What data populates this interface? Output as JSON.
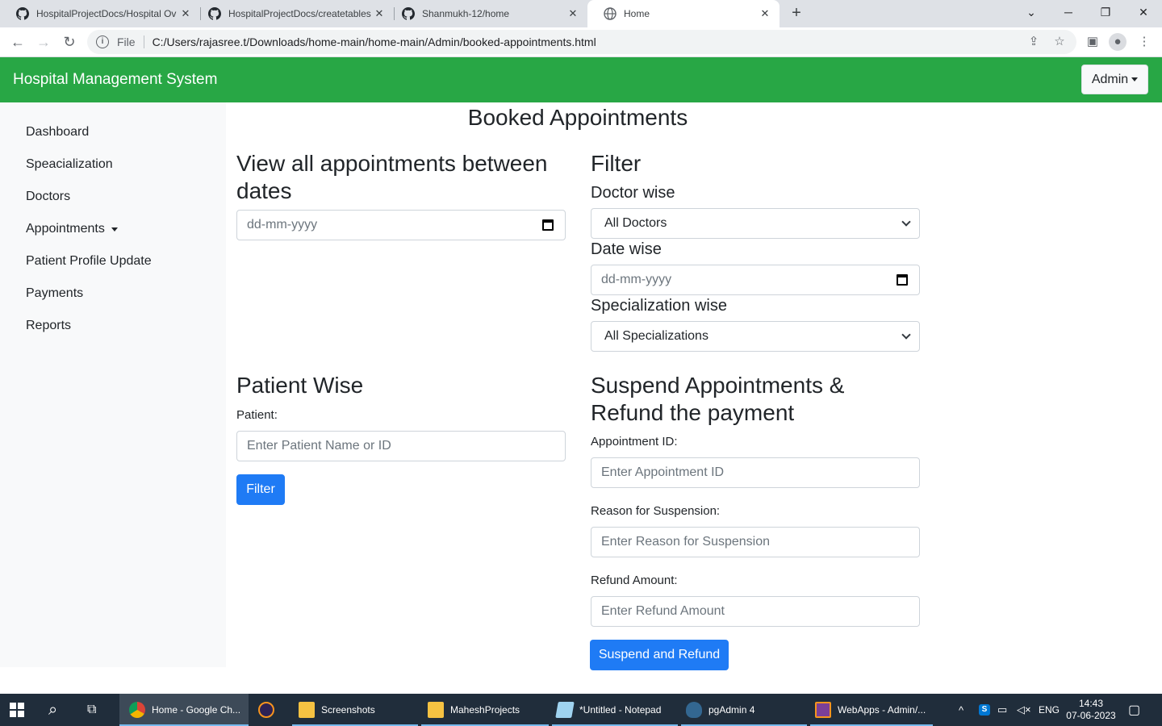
{
  "browser": {
    "tabs": [
      {
        "title": "HospitalProjectDocs/Hospital Ov",
        "close": "✕"
      },
      {
        "title": "HospitalProjectDocs/createtables",
        "close": "✕"
      },
      {
        "title": "Shanmukh-12/home",
        "close": "✕"
      },
      {
        "title": "Home",
        "close": "✕"
      }
    ],
    "new_tab": "+",
    "address": {
      "scheme_label": "File",
      "url": "C:/Users/rajasree.t/Downloads/home-main/home-main/Admin/booked-appointments.html"
    }
  },
  "app": {
    "brand": "Hospital Management System",
    "admin_label": "Admin",
    "sidebar": [
      {
        "label": "Dashboard"
      },
      {
        "label": "Speacialization"
      },
      {
        "label": "Doctors"
      },
      {
        "label": "Appointments"
      },
      {
        "label": "Patient Profile Update"
      },
      {
        "label": "Payments"
      },
      {
        "label": "Reports"
      }
    ],
    "page_title": "Booked Appointments",
    "between_dates": {
      "heading": "View all appointments between dates",
      "date_placeholder": "dd-mm-yyyy"
    },
    "filter": {
      "heading": "Filter",
      "doctor_label": "Doctor wise",
      "doctor_value": "All Doctors",
      "date_label": "Date wise",
      "date_placeholder": "dd-mm-yyyy",
      "spec_label": "Specialization wise",
      "spec_value": "All Specializations"
    },
    "patient": {
      "heading": "Patient Wise",
      "label": "Patient:",
      "placeholder": "Enter Patient Name or ID",
      "button": "Filter"
    },
    "suspend": {
      "heading": "Suspend Appointments & Refund the payment",
      "appt_label": "Appointment ID:",
      "appt_placeholder": "Enter Appointment ID",
      "reason_label": "Reason for Suspension:",
      "reason_placeholder": "Enter Reason for Suspension",
      "refund_label": "Refund Amount:",
      "refund_placeholder": "Enter Refund Amount",
      "button": "Suspend and Refund"
    }
  },
  "taskbar": {
    "items": [
      {
        "label": "Home - Google Ch..."
      },
      {
        "label": ""
      },
      {
        "label": "Screenshots"
      },
      {
        "label": "MaheshProjects"
      },
      {
        "label": "*Untitled - Notepad"
      },
      {
        "label": "pgAdmin 4"
      },
      {
        "label": "WebApps - Admin/..."
      }
    ],
    "lang": "ENG",
    "time": "14:43",
    "date": "07-06-2023"
  }
}
